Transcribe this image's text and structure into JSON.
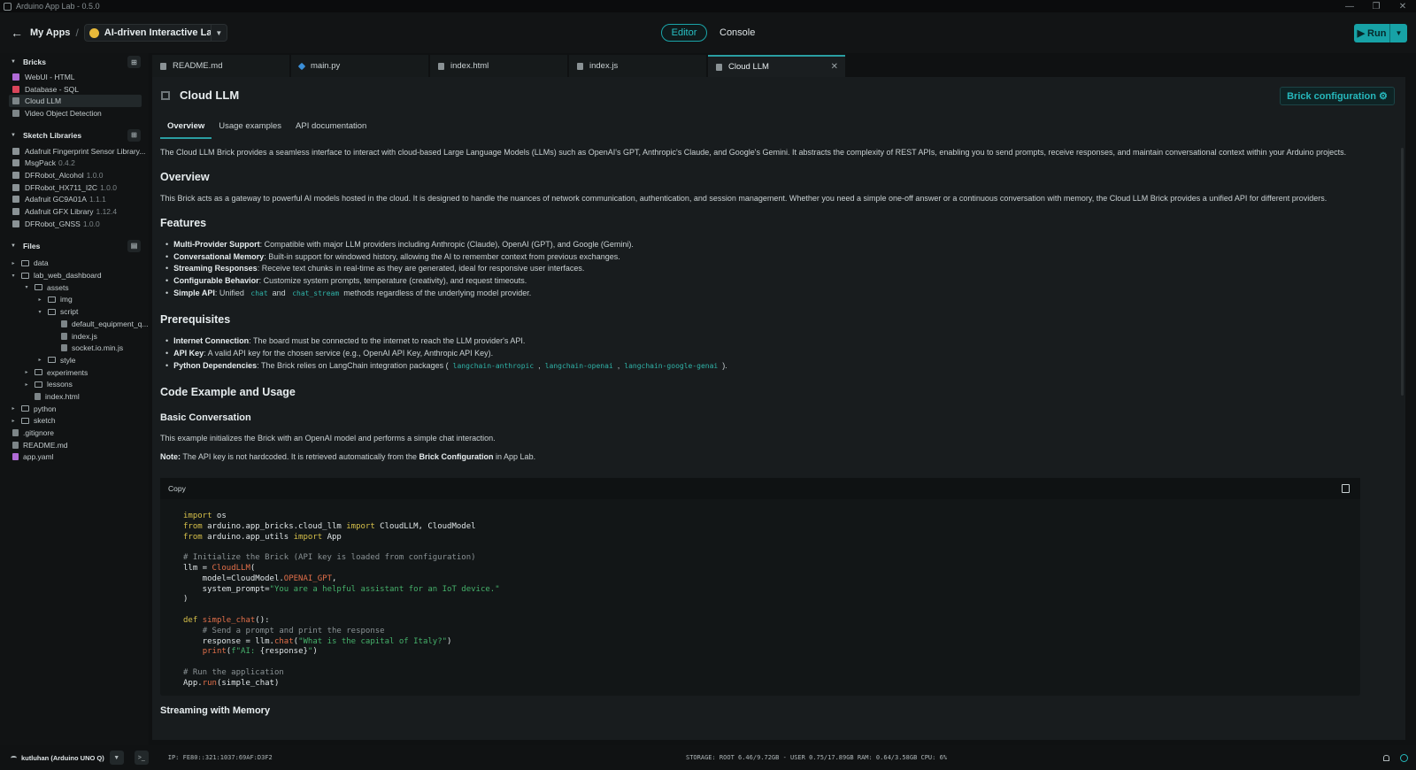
{
  "window": {
    "title": "Arduino App Lab - 0.5.0",
    "controls": [
      "—",
      "❐",
      "✕"
    ]
  },
  "header": {
    "back_icon": "arrow-left-icon",
    "breadcrumb_root": "My Apps",
    "separator": "/",
    "app_name": "AI-driven Interactive Lab ...",
    "mode_editor": "Editor",
    "mode_console": "Console",
    "run_label": "Run"
  },
  "sidebar": {
    "bricks": {
      "title": "Bricks",
      "items": [
        {
          "label": "WebUI - HTML",
          "color": "#b06bd6"
        },
        {
          "label": "Database - SQL",
          "color": "#d9455a"
        },
        {
          "label": "Cloud LLM",
          "color": "#7d8588"
        },
        {
          "label": "Video Object Detection",
          "color": "#7d8588"
        }
      ]
    },
    "libraries": {
      "title": "Sketch Libraries",
      "items": [
        {
          "label": "Adafruit Fingerprint Sensor Library...",
          "version": ""
        },
        {
          "label": "MsgPack",
          "version": "0.4.2"
        },
        {
          "label": "DFRobot_Alcohol",
          "version": "1.0.0"
        },
        {
          "label": "DFRobot_HX711_I2C",
          "version": "1.0.0"
        },
        {
          "label": "Adafruit GC9A01A",
          "version": "1.1.1"
        },
        {
          "label": "Adafruit GFX Library",
          "version": "1.12.4"
        },
        {
          "label": "DFRobot_GNSS",
          "version": "1.0.0"
        }
      ]
    },
    "files": {
      "title": "Files",
      "tree": [
        {
          "label": "data",
          "type": "folder",
          "depth": 0,
          "arrow": "▸"
        },
        {
          "label": "lab_web_dashboard",
          "type": "folder",
          "depth": 0,
          "arrow": "▾"
        },
        {
          "label": "assets",
          "type": "folder",
          "depth": 1,
          "arrow": "▾"
        },
        {
          "label": "img",
          "type": "folder",
          "depth": 2,
          "arrow": "▸"
        },
        {
          "label": "script",
          "type": "folder",
          "depth": 2,
          "arrow": "▾"
        },
        {
          "label": "default_equipment_q...",
          "type": "file",
          "depth": 3,
          "arrow": ""
        },
        {
          "label": "index.js",
          "type": "file",
          "depth": 3,
          "arrow": ""
        },
        {
          "label": "socket.io.min.js",
          "type": "file",
          "depth": 3,
          "arrow": ""
        },
        {
          "label": "style",
          "type": "folder",
          "depth": 2,
          "arrow": "▸"
        },
        {
          "label": "experiments",
          "type": "folder",
          "depth": 1,
          "arrow": "▸"
        },
        {
          "label": "lessons",
          "type": "folder",
          "depth": 1,
          "arrow": "▸"
        },
        {
          "label": "index.html",
          "type": "file",
          "depth": 1,
          "arrow": ""
        },
        {
          "label": "python",
          "type": "folder",
          "depth": 0,
          "arrow": "▸"
        },
        {
          "label": "sketch",
          "type": "folder",
          "depth": 0,
          "arrow": "▸"
        },
        {
          "label": ".gitignore",
          "type": "file",
          "depth": 0,
          "arrow": ""
        },
        {
          "label": "README.md",
          "type": "file",
          "depth": 0,
          "arrow": ""
        },
        {
          "label": "app.yaml",
          "type": "file",
          "depth": 0,
          "arrow": ""
        }
      ]
    }
  },
  "tabs": [
    {
      "label": "README.md",
      "active": false
    },
    {
      "label": "main.py",
      "active": false
    },
    {
      "label": "index.html",
      "active": false
    },
    {
      "label": "index.js",
      "active": false
    },
    {
      "label": "Cloud LLM",
      "active": true
    }
  ],
  "brick": {
    "title": "Cloud LLM",
    "config_button": "Brick configuration ⚙",
    "subtabs": [
      "Overview",
      "Usage examples",
      "API documentation"
    ],
    "intro": "The Cloud LLM Brick provides a seamless interface to interact with cloud-based Large Language Models (LLMs) such as OpenAI's GPT, Anthropic's Claude, and Google's Gemini. It abstracts the complexity of REST APIs, enabling you to send prompts, receive responses, and maintain conversational context within your Arduino projects.",
    "overview_h": "Overview",
    "overview_p": "This Brick acts as a gateway to powerful AI models hosted in the cloud. It is designed to handle the nuances of network communication, authentication, and session management. Whether you need a simple one-off answer or a continuous conversation with memory, the Cloud LLM Brick provides a unified API for different providers.",
    "features_h": "Features",
    "features": [
      {
        "b": "Multi-Provider Support",
        "t": ": Compatible with major LLM providers including Anthropic (Claude), OpenAI (GPT), and Google (Gemini)."
      },
      {
        "b": "Conversational Memory",
        "t": ": Built-in support for windowed history, allowing the AI to remember context from previous exchanges."
      },
      {
        "b": "Streaming Responses",
        "t": ": Receive text chunks in real-time as they are generated, ideal for responsive user interfaces."
      },
      {
        "b": "Configurable Behavior",
        "t": ": Customize system prompts, temperature (creativity), and request timeouts."
      }
    ],
    "simple_api_b": "Simple API",
    "simple_api_t1": ": Unified",
    "simple_api_c1": "chat",
    "simple_api_t2": "and",
    "simple_api_c2": "chat_stream",
    "simple_api_t3": "methods regardless of the underlying model provider.",
    "prereq_h": "Prerequisites",
    "prereq": [
      {
        "b": "Internet Connection",
        "t": ": The board must be connected to the internet to reach the LLM provider's API."
      },
      {
        "b": "API Key",
        "t": ": A valid API key for the chosen service (e.g., OpenAI API Key, Anthropic API Key)."
      }
    ],
    "py_deps_b": "Python Dependencies",
    "py_deps_t": ": The Brick relies on LangChain integration packages (",
    "py_deps_c1": "langchain-anthropic",
    "py_deps_c2": "langchain-openai",
    "py_deps_c3": "langchain-google-genai",
    "py_deps_end": ").",
    "code_h": "Code Example and Usage",
    "basic_h": "Basic Conversation",
    "basic_p": "This example initializes the Brick with an OpenAI model and performs a simple chat interaction.",
    "note_b": "Note:",
    "note_t1": "The API key is not hardcoded. It is retrieved automatically from the",
    "note_b2": "Brick Configuration",
    "note_t2": "in App Lab.",
    "copy_label": "Copy",
    "stream_h": "Streaming with Memory"
  },
  "status": {
    "board": "kutluhan (Arduino UNO Q)",
    "ip": "IP: FE80::321:1037:69AF:D3F2",
    "stats": "STORAGE: ROOT 6.46/9.72GB - USER 0.75/17.89GB   RAM: 0.64/3.58GB   CPU: 6%"
  },
  "colors": {
    "accent": "#17a2a6",
    "background": "#0f1112"
  }
}
